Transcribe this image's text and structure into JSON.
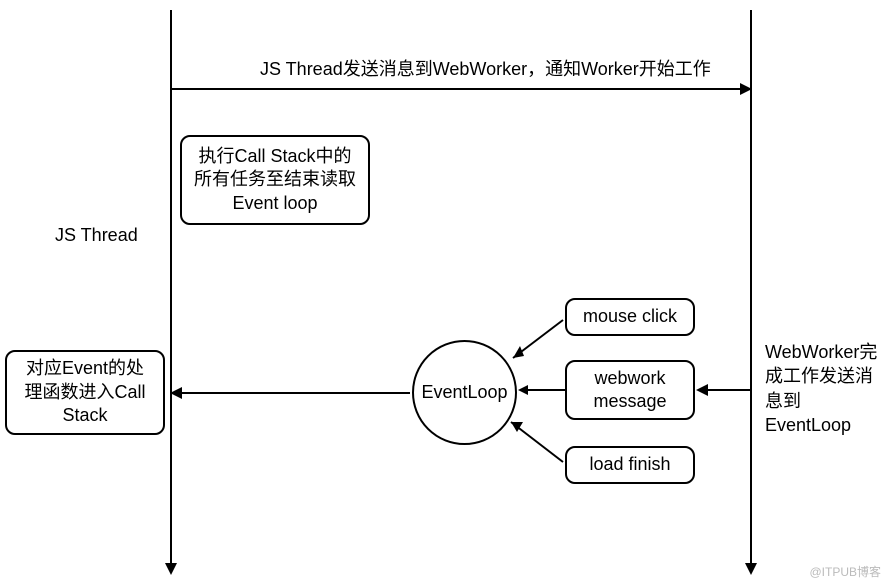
{
  "topMessage": "JS Thread发送消息到WebWorker，通知Worker开始工作",
  "jsThreadLabel": "JS Thread",
  "callStackBox": "执行Call Stack中的所有任务至结束读取Event loop",
  "eventHandlerBox": "对应Event的处理函数进入Call Stack",
  "eventLoop": "EventLoop",
  "events": {
    "mouseClick": "mouse click",
    "webworkMessage": "webwork message",
    "loadFinish": "load finish"
  },
  "webWorkerBox": "WebWorker完成工作发送消息到EventLoop",
  "watermark": "@ITPUB博客"
}
